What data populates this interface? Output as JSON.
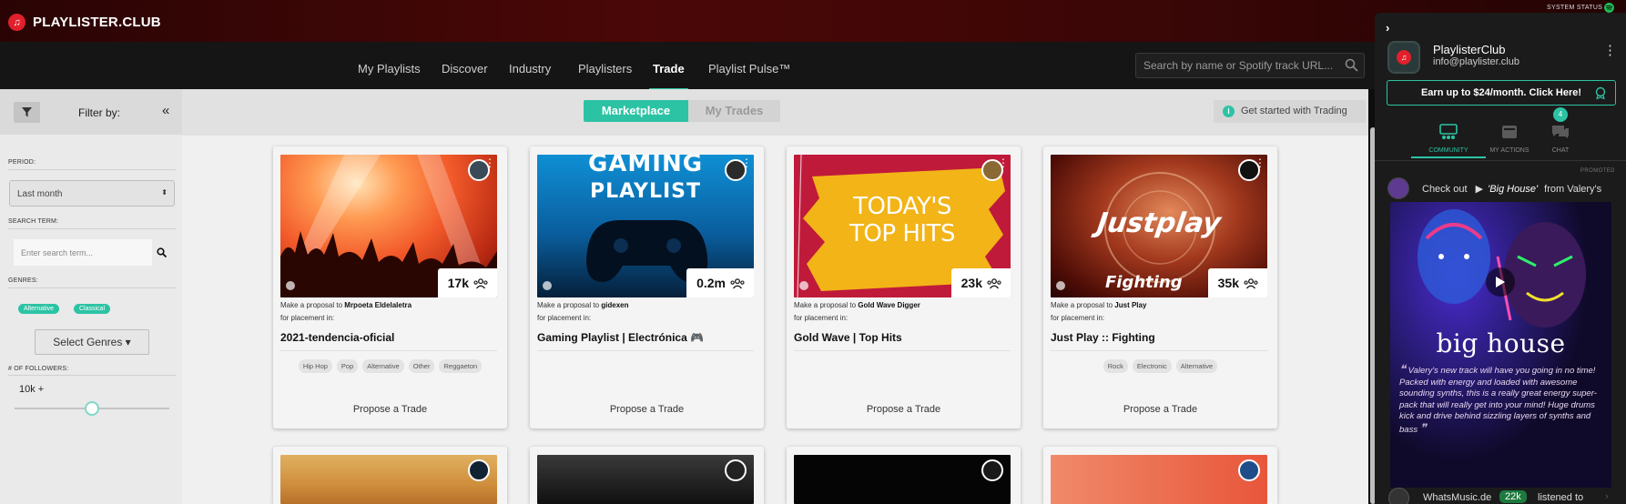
{
  "app": {
    "brand": "PLAYLISTER.CLUB",
    "system_status": "SYSTEM STATUS"
  },
  "nav": {
    "items": [
      "My Playlists",
      "Discover",
      "Industry",
      "Playlisters",
      "Trade",
      "Playlist Pulse™"
    ],
    "active": "Trade",
    "search_placeholder": "Search by name or Spotify track URL..."
  },
  "sidebar": {
    "filter_label": "Filter by:",
    "period_label": "PERIOD:",
    "period_value": "Last month",
    "search_term_label": "SEARCH TERM:",
    "search_term_placeholder": "Enter search term...",
    "genres_label": "GENRES:",
    "genres": [
      "Alternative",
      "Classical"
    ],
    "select_genres": "Select Genres",
    "followers_label": "# OF FOLLOWERS:",
    "followers_value": "10k +"
  },
  "main": {
    "tabs": [
      "Marketplace",
      "My Trades"
    ],
    "active_tab": "Marketplace",
    "get_started": "Get started with Trading",
    "proposal_prefix": "Make a proposal to",
    "placement_text": "for placement in:",
    "cards": [
      {
        "owner": "Mrpoeta Eldelaletra",
        "followers": "17k",
        "name": "2021-tendencia-oficial",
        "tags": [
          "Hip Hop",
          "Pop",
          "Alternative",
          "Other",
          "Reggaeton"
        ],
        "cta": "Propose a Trade"
      },
      {
        "owner": "gidexen",
        "followers": "0.2m",
        "name": "Gaming Playlist | Electrónica 🎮",
        "tags": [],
        "cta": "Propose a Trade",
        "cover_title_1": "GAMING",
        "cover_title_2": "PLAYLIST"
      },
      {
        "owner": "Gold Wave Digger",
        "followers": "23k",
        "name": "Gold Wave | Top Hits",
        "tags": [],
        "cta": "Propose a Trade",
        "cover_title_1": "TODAY'S",
        "cover_title_2": "TOP HITS"
      },
      {
        "owner": "Just Play",
        "followers": "35k",
        "name": "Just Play :: Fighting",
        "tags": [
          "Rock",
          "Electronic",
          "Alternative"
        ],
        "cta": "Propose a Trade",
        "cover_title_1": "Justplay",
        "cover_title_2": "Fighting"
      }
    ]
  },
  "right_panel": {
    "name": "PlaylisterClub",
    "email": "info@playlister.club",
    "earn_cta": "Earn up to $24/month. Click Here!",
    "tabs": [
      "COMMUNITY",
      "MY ACTIONS",
      "CHAT"
    ],
    "active_tab": "COMMUNITY",
    "chat_badge": "4",
    "promoted_label": "PROMOTED",
    "feed_check_out": "Check out",
    "feed_track": "'Big House'",
    "feed_from": "from Valery's",
    "promo_title": "big house",
    "promo_quote": "Valery's new track will have you going in no time! Packed with energy and loaded with awesome sounding synths, this is a really great energy super-pack that will really get into your mind! Huge drums kick and drive behind sizzling layers of synths and bass",
    "next_user": "WhatsMusic.de",
    "next_badge": "22k",
    "next_action": "listened to"
  },
  "colors": {
    "accent": "#2cc3a4",
    "brand_red": "#e0202b",
    "topbar": "#3b0606"
  }
}
